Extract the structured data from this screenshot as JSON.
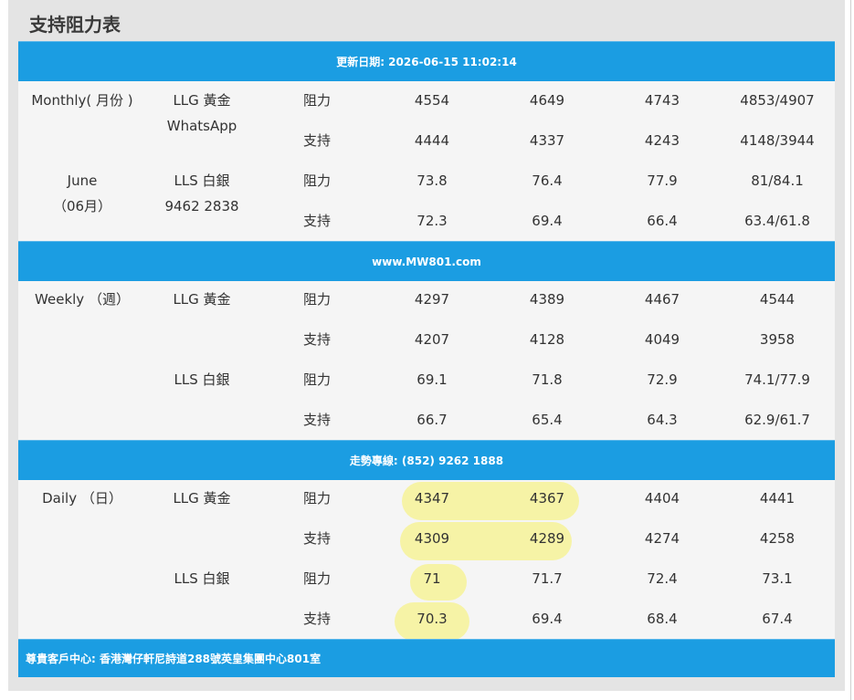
{
  "page": {
    "title": "支持阻力表"
  },
  "bands": {
    "updated": "更新日期: 2026-06-15 11:02:14",
    "website": "www.MW801.com",
    "hotline": "走勢專線: (852) 9262 1888",
    "address": "尊貴客戶中心: 香港灣仔軒尼詩道288號英皇集團中心801室"
  },
  "monthly": {
    "period_line1": "Monthly( 月份 )",
    "period_line2": "June",
    "period_line3": "（06月）",
    "llg_label": "LLG 黃金",
    "whatsapp_label": "WhatsApp",
    "lls_label": "LLS 白銀",
    "phone": "9462 2838",
    "rows": [
      {
        "type": "阻力",
        "v1": "4554",
        "v2": "4649",
        "v3": "4743",
        "v4": "4853/4907"
      },
      {
        "type": "支持",
        "v1": "4444",
        "v2": "4337",
        "v3": "4243",
        "v4": "4148/3944"
      },
      {
        "type": "阻力",
        "v1": "73.8",
        "v2": "76.4",
        "v3": "77.9",
        "v4": "81/84.1"
      },
      {
        "type": "支持",
        "v1": "72.3",
        "v2": "69.4",
        "v3": "66.4",
        "v4": "63.4/61.8"
      }
    ]
  },
  "weekly": {
    "period": "Weekly （週）",
    "llg_label": "LLG 黃金",
    "lls_label": "LLS 白銀",
    "rows": [
      {
        "type": "阻力",
        "v1": "4297",
        "v2": "4389",
        "v3": "4467",
        "v4": "4544"
      },
      {
        "type": "支持",
        "v1": "4207",
        "v2": "4128",
        "v3": "4049",
        "v4": "3958"
      },
      {
        "type": "阻力",
        "v1": "69.1",
        "v2": "71.8",
        "v3": "72.9",
        "v4": "74.1/77.9"
      },
      {
        "type": "支持",
        "v1": "66.7",
        "v2": "65.4",
        "v3": "64.3",
        "v4": "62.9/61.7"
      }
    ]
  },
  "daily": {
    "period": "Daily （日）",
    "llg_label": "LLG 黃金",
    "lls_label": "LLS 白銀",
    "rows": [
      {
        "type": "阻力",
        "v1": "4347",
        "v2": "4367",
        "v3": "4404",
        "v4": "4441"
      },
      {
        "type": "支持",
        "v1": "4309",
        "v2": "4289",
        "v3": "4274",
        "v4": "4258"
      },
      {
        "type": "阻力",
        "v1": "71",
        "v2": "71.7",
        "v3": "72.4",
        "v4": "73.1"
      },
      {
        "type": "支持",
        "v1": "70.3",
        "v2": "69.4",
        "v3": "68.4",
        "v4": "67.4"
      }
    ]
  },
  "colors": {
    "band": "#1b9de2",
    "highlight": "#f6f3a6",
    "panel": "#e4e4e4"
  }
}
